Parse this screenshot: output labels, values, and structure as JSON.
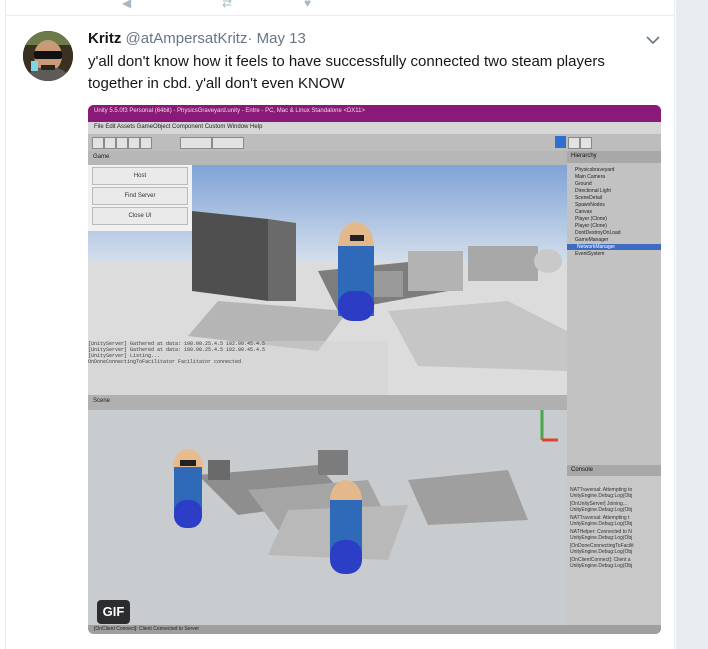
{
  "tweet": {
    "author_name": "Kritz",
    "author_handle": "@atAmpersatKritz",
    "separator": "·",
    "date": "May 13",
    "text": "y'all don't know how it feels to have successfully connected two steam players together in cbd. y'all don't even KNOW"
  },
  "media": {
    "badge": "GIF",
    "unity": {
      "title": "Unity 5.5.0f3 Personal (64bit) - PhysicsGraveyard.unity - Entre - PC, Mac & Linux Standalone <DX11>",
      "menu": "File   Edit   Assets   GameObject   Component   Custom   Window   Help",
      "game_tab": "Game",
      "scene_tab": "Scene",
      "hierarchy_tab": "Hierarchy",
      "hierarchy_items": [
        "Physicsbraveyard",
        "Main Camera",
        "Ground",
        "Directional Light",
        "SceneDetail",
        "SpawnNodes",
        "Canvas",
        "Player (Clone)",
        "Player (Clone)",
        "DontDestroyOnLoad",
        "GameManager",
        "NetworkManager",
        "EventSystem"
      ],
      "net_buttons": [
        "Host",
        "Find Server",
        "Close UI"
      ],
      "console_tab": "Console",
      "console_lines": [
        "NATTraversal: Attempting to",
        "UnityEngine.Debug:Log(Obj",
        "[OnUnityServer] Joining...",
        "UnityEngine.Debug:Log(Obj",
        "NATTraversal: Attempting t",
        "UnityEngine.Debug:Log(Obj",
        "NATHelper: Connected to N",
        "UnityEngine.Debug:Log(Obj",
        "[OnDoneConnectingToFacilit",
        "UnityEngine.Debug:Log(Obj",
        "[OnClientConnect]: Client a",
        "UnityEngine.Debug:Log(Obj"
      ],
      "game_log_lines": [
        "[UnityServer] Gathered at data: 100.00.25.4.5 102.00.45.4.5",
        "[UnityServer] Gathered at data: 100.00.25.4.5 102.00.45.4.5",
        "[UnityServer] Listing...",
        "OnDoneConnectingToFacilitator Facilitator connected"
      ],
      "status": "[OnClient Connect]: Client Connected to Server"
    }
  }
}
